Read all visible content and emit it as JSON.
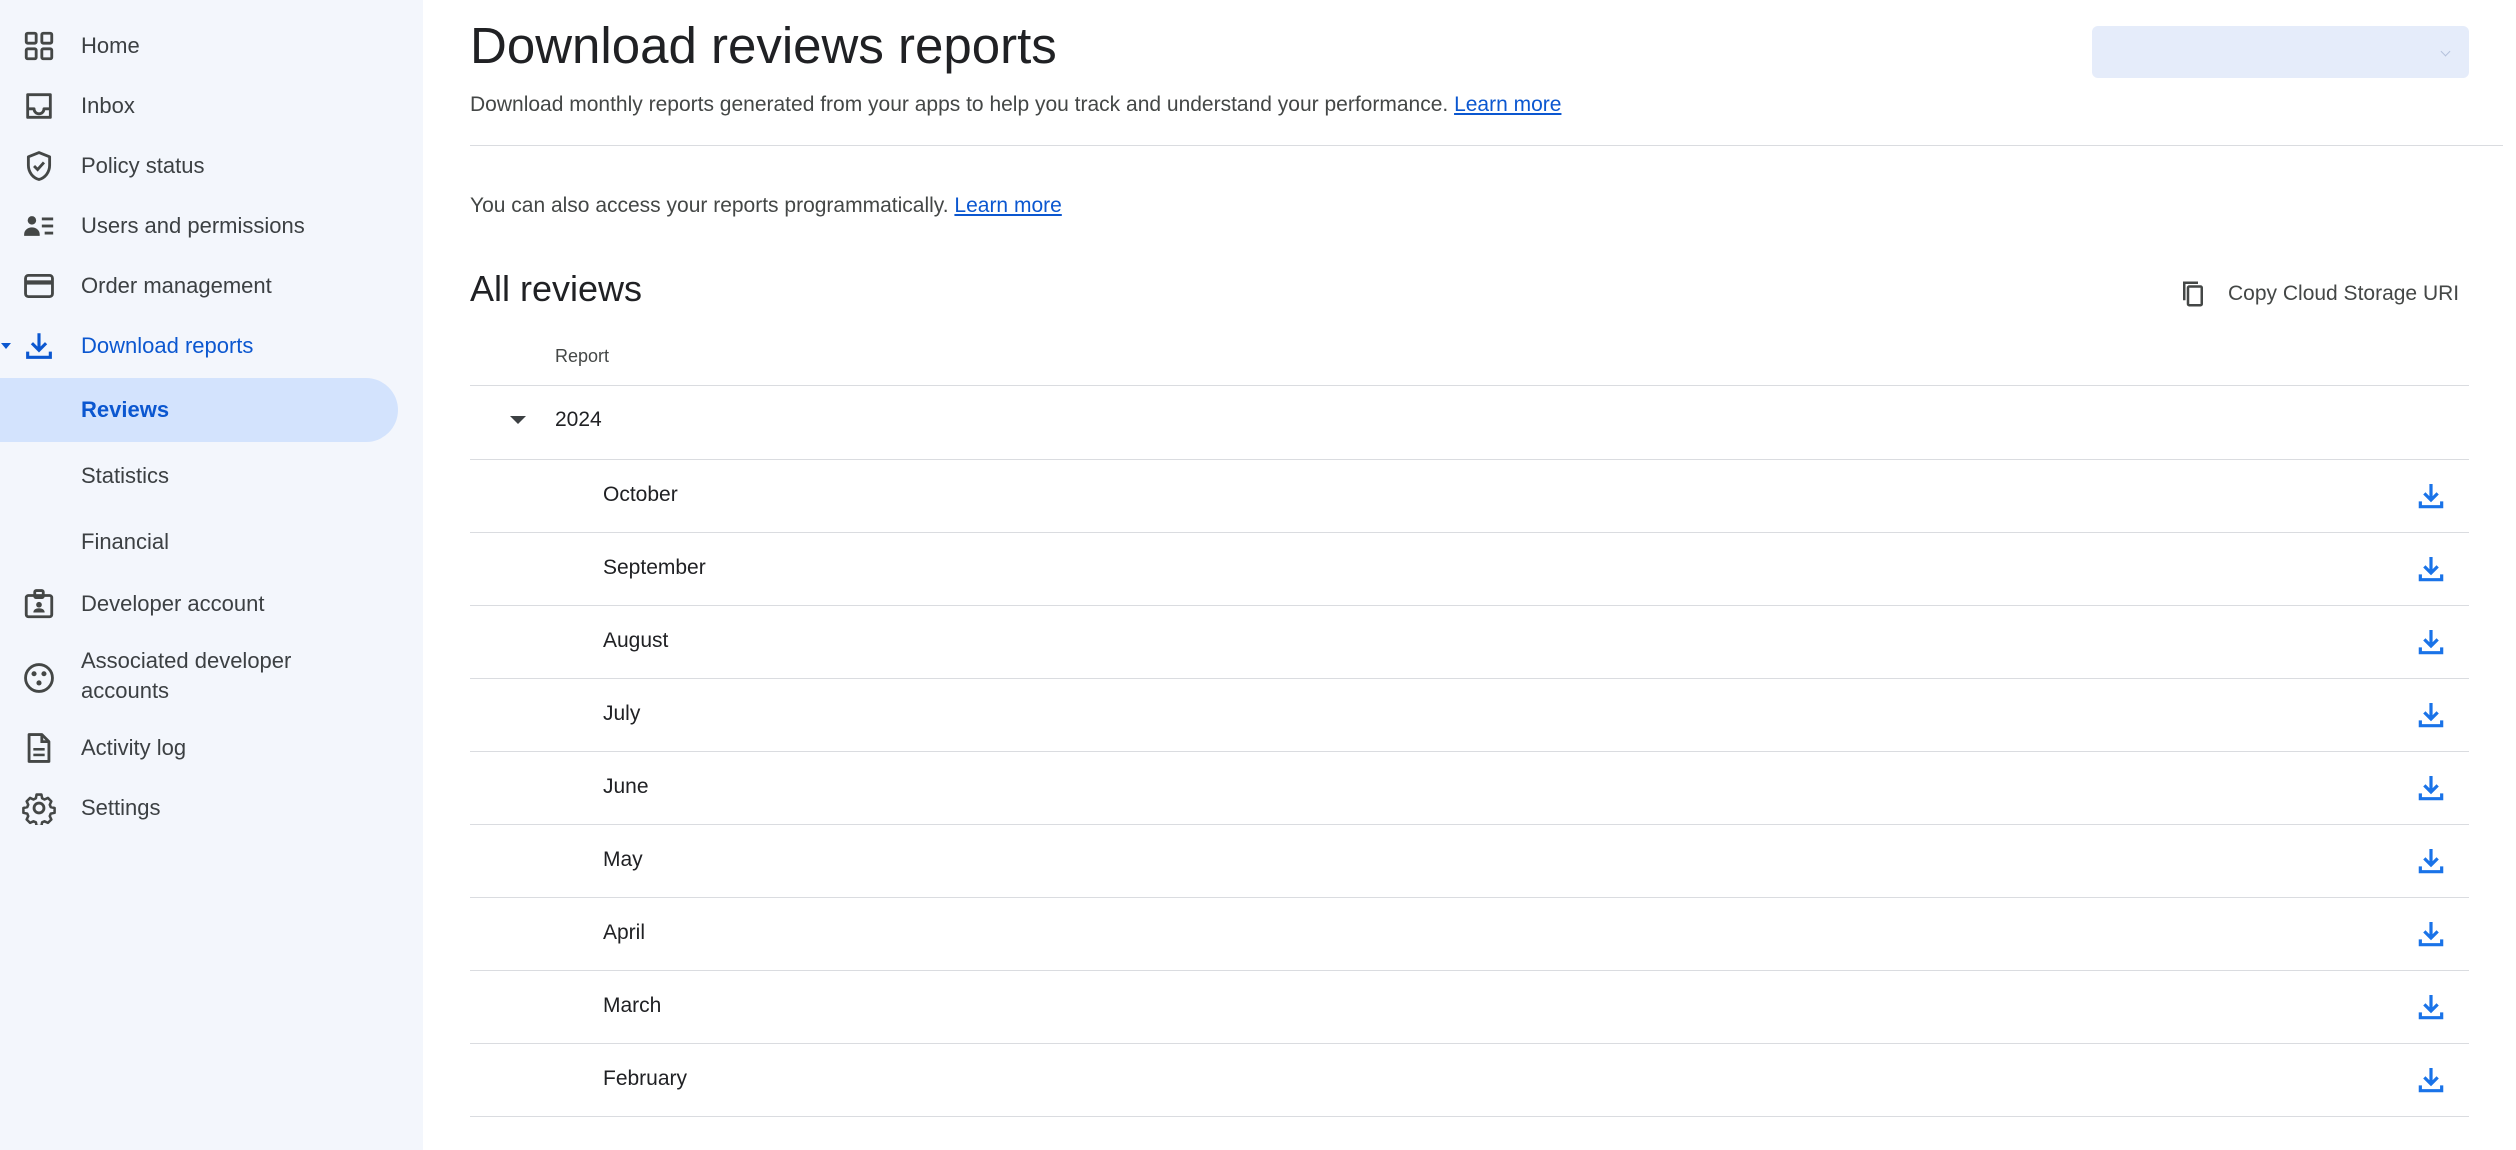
{
  "sidebar": {
    "items": [
      {
        "label": "Home",
        "icon": "grid-icon"
      },
      {
        "label": "Inbox",
        "icon": "inbox-icon"
      },
      {
        "label": "Policy status",
        "icon": "shield-check-icon"
      },
      {
        "label": "Users and permissions",
        "icon": "user-list-icon"
      },
      {
        "label": "Order management",
        "icon": "credit-card-icon"
      },
      {
        "label": "Download reports",
        "icon": "download-icon",
        "expanded": true
      },
      {
        "label": "Developer account",
        "icon": "id-badge-icon"
      },
      {
        "label": "Associated developer accounts",
        "icon": "linked-accounts-icon"
      },
      {
        "label": "Activity log",
        "icon": "document-icon"
      },
      {
        "label": "Settings",
        "icon": "gear-icon"
      }
    ],
    "subitems": [
      {
        "label": "Reviews",
        "selected": true
      },
      {
        "label": "Statistics"
      },
      {
        "label": "Financial"
      }
    ]
  },
  "header": {
    "title": "Download reviews reports",
    "subtitle": "Download monthly reports generated from your apps to help you track and understand your performance.",
    "learn_more": "Learn more"
  },
  "programmatic": {
    "text": "You can also access your reports programmatically.",
    "learn_more": "Learn more"
  },
  "section": {
    "title": "All reviews",
    "copy_button": "Copy Cloud Storage URI",
    "column_header": "Report",
    "year": "2024",
    "months": [
      "October",
      "September",
      "August",
      "July",
      "June",
      "May",
      "April",
      "March",
      "February"
    ]
  },
  "colors": {
    "accent": "#0b57d0",
    "sidebar_bg": "#f3f6fc",
    "selected_bg": "#d3e3fd",
    "download_icon": "#1a73e8"
  }
}
